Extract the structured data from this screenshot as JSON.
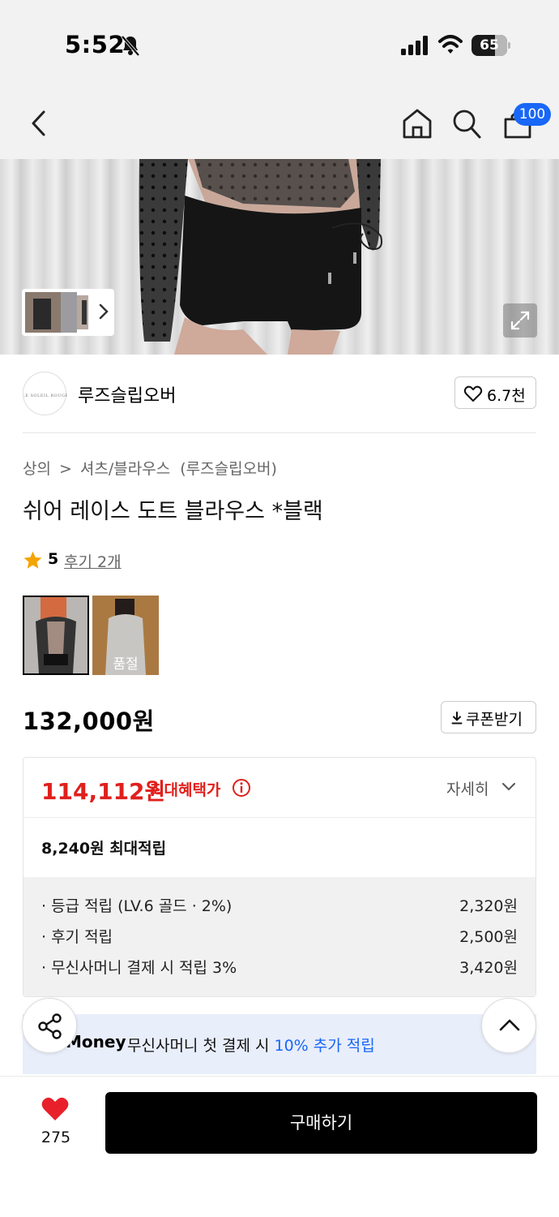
{
  "status_bar": {
    "time": "5:52",
    "battery": "65",
    "battery_level": 0.65,
    "icons": [
      "bell-slash-icon",
      "signal-icon",
      "wifi-icon",
      "battery-icon"
    ]
  },
  "header": {
    "icons": [
      "chevron-left-icon",
      "home-icon",
      "search-icon",
      "cart-icon"
    ],
    "cart_badge": "100"
  },
  "brand": {
    "logo_text": "LE SOLEIL ROUGE",
    "name": "루즈슬립오버",
    "like_count": "6.7천"
  },
  "breadcrumb": {
    "category": "상의",
    "subcategory": "셔츠/블라우스",
    "brand": "(루즈슬립오버)"
  },
  "product": {
    "title": "쉬어 레이스 도트 블라우스 *블랙",
    "rating": "5",
    "reviews": "후기 2개",
    "variant_sold_out": "품절"
  },
  "price": {
    "original": "132,000원",
    "coupon": "쿠폰받기"
  },
  "benefits": {
    "max_price": "114,112원",
    "max_price_label": "최대혜택가",
    "detail_label": "자세히",
    "max_points": "8,240원 최대적립",
    "rows": [
      {
        "label": "· 등급 적립 (LV.6 골드 · 2%)",
        "value": "2,320원"
      },
      {
        "label": "· 후기 적립",
        "value": "2,500원"
      },
      {
        "label": "· 무신사머니 결제 시 적립 3%",
        "value": "3,420원"
      }
    ]
  },
  "money_banner": {
    "logo": "Money",
    "text": "무신사머니 첫 결제 시 ",
    "highlight": "10% 추가 적립"
  },
  "bottom_bar": {
    "wish_count": "275",
    "buy_label": "구매하기"
  },
  "colors": {
    "accent_blue": "#1867f7",
    "price_red": "#e0201c",
    "banner_bg": "#e9eefb",
    "heart_red": "#e8202a"
  }
}
